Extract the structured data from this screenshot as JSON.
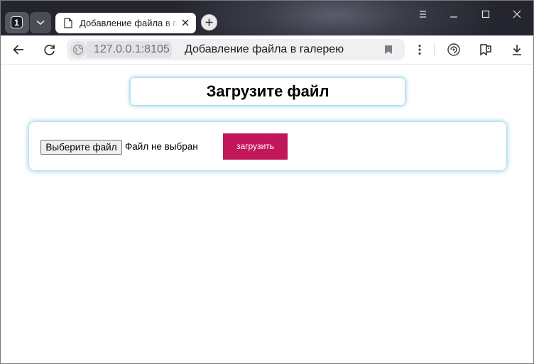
{
  "browser": {
    "tab_count": "1",
    "active_tab_title": "Добавление файла в галерею",
    "address_host": "127.0.0.1:8105",
    "address_page_title": "Добавление файла в галерею",
    "icons": {
      "tab_counter": "tab-counter-icon",
      "tab_list": "chevron-down-icon",
      "tab_favicon": "document-icon",
      "tab_close": "close-icon",
      "new_tab": "plus-icon",
      "menu": "hamburger-menu-icon",
      "minimize": "minimize-icon",
      "maximize": "maximize-icon",
      "close_window": "close-icon",
      "back": "back-arrow-icon",
      "reload": "reload-icon",
      "site_info": "globe-icon",
      "bookmark": "bookmark-icon",
      "more": "more-vertical-icon",
      "alice": "alice-assistant-icon",
      "collections": "collections-icon",
      "downloads": "download-icon"
    }
  },
  "page": {
    "heading": "Загрузите файл",
    "file_input": {
      "button_label": "Выберите файл",
      "status": "Файл не выбран"
    },
    "submit_label": "загрузить",
    "colors": {
      "accent": "#c2185b",
      "card_glow": "#52b2d6"
    }
  }
}
